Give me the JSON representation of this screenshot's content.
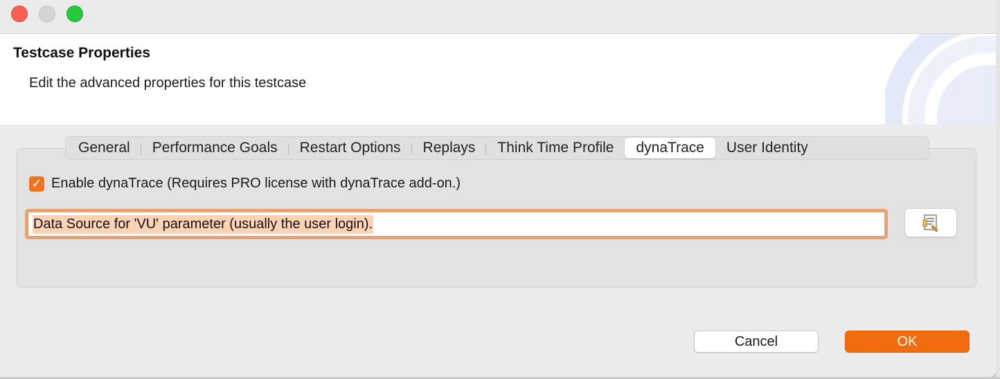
{
  "window": {
    "traffic_lights": [
      "close",
      "minimize",
      "maximize"
    ]
  },
  "header": {
    "title": "Testcase Properties",
    "description": "Edit the advanced properties for this testcase"
  },
  "tabs": [
    {
      "label": "General",
      "active": false
    },
    {
      "label": "Performance Goals",
      "active": false
    },
    {
      "label": "Restart Options",
      "active": false
    },
    {
      "label": "Replays",
      "active": false
    },
    {
      "label": "Think Time Profile",
      "active": false
    },
    {
      "label": "dynaTrace",
      "active": true
    },
    {
      "label": "User Identity",
      "active": false
    }
  ],
  "dynatrace": {
    "enable_checkbox": {
      "checked": true,
      "label": "Enable dynaTrace (Requires PRO license with dynaTrace add-on.)"
    },
    "data_source_field": {
      "value": "Data Source for 'VU' parameter (usually the user login).",
      "selected": true
    },
    "browse_button_icon": "document-edit-icon"
  },
  "footer": {
    "cancel_label": "Cancel",
    "ok_label": "OK"
  },
  "colors": {
    "accent": "#f26b0f",
    "focus_ring": "#e9a273",
    "selection": "#fdd2b5"
  }
}
